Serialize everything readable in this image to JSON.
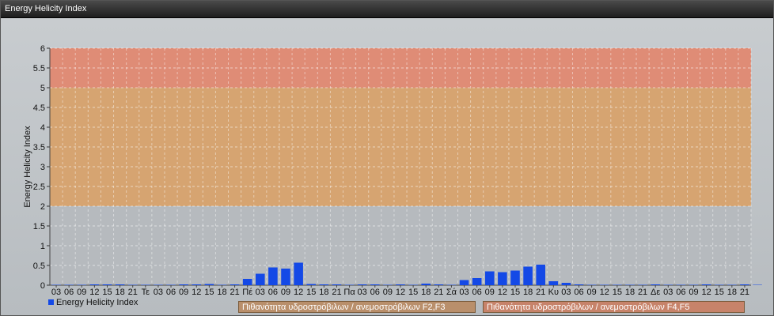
{
  "window": {
    "title": "Energy Helicity Index"
  },
  "colors": {
    "bar": "#1449e6",
    "band_low": "#b8bcc0",
    "band_mid": "#dba46c",
    "band_high": "#e58a72",
    "band_label_1": "#b98f6b",
    "band_label_2": "#c7836a"
  },
  "band_labels": [
    "Πιθανότητα υδροστρόβιλων / ανεμοστρόβιλων F2,F3",
    "Πιθανότητα υδροστρόβιλων / ανεμοστρόβιλων F4,F5"
  ],
  "chart_data": {
    "type": "bar",
    "title": "",
    "ylabel": "Energy Helicity Index",
    "xlabel": "",
    "ylim": [
      0,
      6
    ],
    "y_ticks": [
      "0",
      "0.5",
      "1",
      "1.5",
      "2",
      "2.5",
      "3",
      "3.5",
      "4",
      "4.5",
      "5",
      "5.5",
      "6"
    ],
    "bands": [
      {
        "from": 0,
        "to": 2,
        "color": "#b8bcc0"
      },
      {
        "from": 2,
        "to": 5,
        "color": "#dba46c"
      },
      {
        "from": 5,
        "to": 6,
        "color": "#e58a72"
      }
    ],
    "categories": [
      "03",
      "06",
      "09",
      "12",
      "15",
      "18",
      "21",
      "Τε",
      "03",
      "06",
      "09",
      "12",
      "15",
      "18",
      "21",
      "Πέ",
      "03",
      "06",
      "09",
      "12",
      "15",
      "18",
      "21",
      "Πα",
      "03",
      "06",
      "09",
      "12",
      "15",
      "18",
      "21",
      "Σά",
      "03",
      "06",
      "09",
      "12",
      "15",
      "18",
      "21",
      "Κυ",
      "03",
      "06",
      "09",
      "12",
      "15",
      "18",
      "21",
      "Δε",
      "03",
      "06",
      "09",
      "12",
      "15",
      "18",
      "21"
    ],
    "series": [
      {
        "name": "Energy Helicity Index",
        "values": [
          0.01,
          0.01,
          0.01,
          0.02,
          0.02,
          0.02,
          0.01,
          0.01,
          0.01,
          0.01,
          0.02,
          0.02,
          0.03,
          0.01,
          0.02,
          0.16,
          0.29,
          0.45,
          0.42,
          0.57,
          0.03,
          0.02,
          0.02,
          0.01,
          0.02,
          0.02,
          0.01,
          0.02,
          0.01,
          0.04,
          0.02,
          0.01,
          0.13,
          0.18,
          0.35,
          0.33,
          0.37,
          0.47,
          0.52,
          0.1,
          0.06,
          0.02,
          0.01,
          0.01,
          0.01,
          0.01,
          0.01,
          0.02,
          0.01,
          0.01,
          0.01,
          0.02,
          0.01,
          0.01,
          0.02,
          0.01
        ]
      }
    ],
    "legend": "bottom-left",
    "grid": true
  }
}
